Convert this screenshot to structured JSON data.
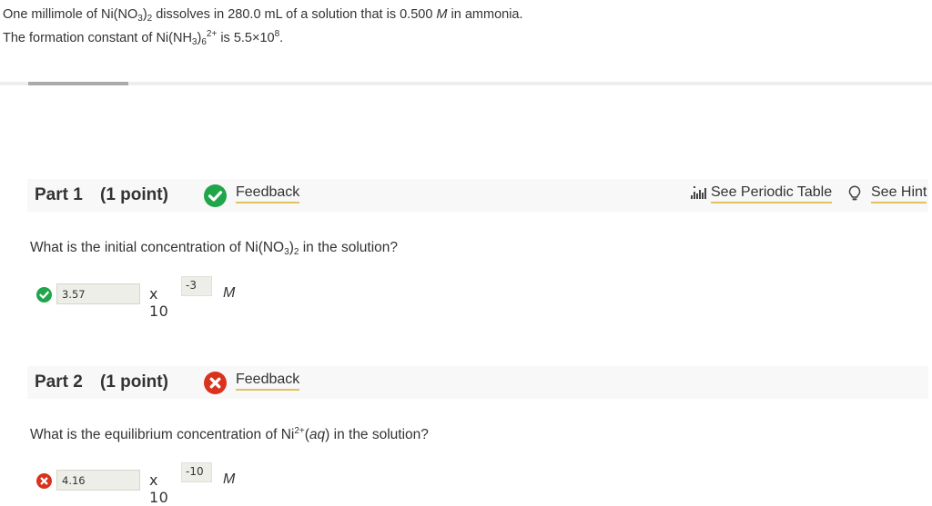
{
  "problem": {
    "line1": {
      "a": "One millimole of Ni(NO",
      "sub1": "3",
      "b": ")",
      "sub2": "2",
      "c": " dissolves in 280.0 mL of a solution that is 0.500 ",
      "unit": "M",
      "d": " in ammonia."
    },
    "line2": {
      "a": "The formation constant of Ni(NH",
      "sub1": "3",
      "b": ")",
      "sub2": "6",
      "sup": "2+",
      "c": " is  5.5×10",
      "exp": "8",
      "d": "."
    }
  },
  "progress": {
    "fraction": 0.11
  },
  "toolbar": {
    "periodic_table_label": "See Periodic Table",
    "hint_label": "See Hint"
  },
  "parts": [
    {
      "title": "Part 1",
      "points": "(1 point)",
      "status": "correct",
      "status_color": "#1fa54a",
      "feedback_label": "Feedback",
      "question": {
        "a": "What is the initial concentration of Ni(NO",
        "sub1": "3",
        "b": ")",
        "sub2": "2",
        "c": " in the solution?"
      },
      "answer": {
        "value": "3.57",
        "times_label": "x 10",
        "exponent": "-3",
        "unit": "M"
      }
    },
    {
      "title": "Part 2",
      "points": "(1 point)",
      "status": "incorrect",
      "status_color": "#d9321f",
      "feedback_label": "Feedback",
      "question": {
        "a": "What is the equilibrium concentration of Ni",
        "sup": "2+",
        "b": "(",
        "italic": "aq",
        "c": ") in the solution?"
      },
      "answer": {
        "value": "4.16",
        "times_label": "x 10",
        "exponent": "-10",
        "unit": "M"
      }
    }
  ]
}
